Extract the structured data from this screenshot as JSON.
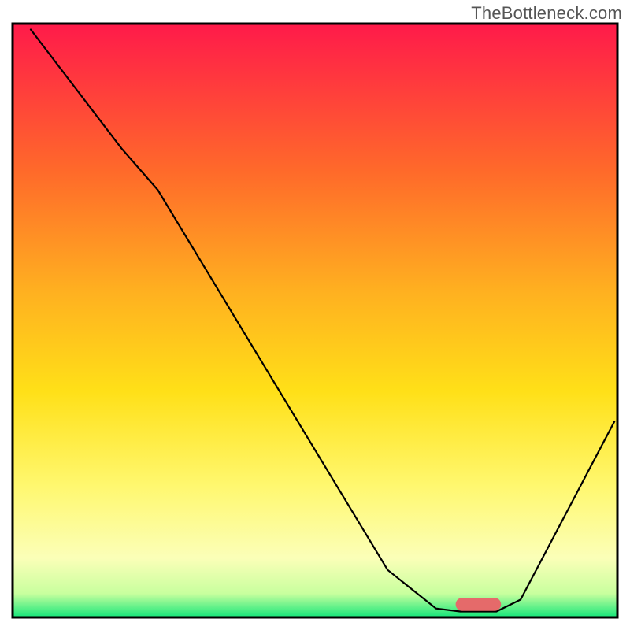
{
  "watermark": "TheBottleneck.com",
  "chart_data": {
    "type": "line",
    "title": "",
    "xlabel": "",
    "ylabel": "",
    "xlim": [
      0,
      100
    ],
    "ylim": [
      0,
      100
    ],
    "gradient_stops": [
      {
        "offset": 0.0,
        "color": "#ff1a4a"
      },
      {
        "offset": 0.25,
        "color": "#ff6a2a"
      },
      {
        "offset": 0.45,
        "color": "#ffb020"
      },
      {
        "offset": 0.62,
        "color": "#ffe018"
      },
      {
        "offset": 0.78,
        "color": "#fff870"
      },
      {
        "offset": 0.9,
        "color": "#fbffb8"
      },
      {
        "offset": 0.96,
        "color": "#c8ff9e"
      },
      {
        "offset": 1.0,
        "color": "#14e67a"
      }
    ],
    "border_color": "#000000",
    "series": [
      {
        "name": "bottleneck-curve",
        "type": "path",
        "stroke": "#000000",
        "stroke_width": 2.2,
        "points": [
          {
            "x": 3.0,
            "y": 99.0
          },
          {
            "x": 18.0,
            "y": 79.0
          },
          {
            "x": 24.0,
            "y": 72.0
          },
          {
            "x": 62.0,
            "y": 8.0
          },
          {
            "x": 70.0,
            "y": 1.5
          },
          {
            "x": 74.0,
            "y": 1.0
          },
          {
            "x": 80.0,
            "y": 1.0
          },
          {
            "x": 84.0,
            "y": 3.0
          },
          {
            "x": 99.5,
            "y": 33.0
          }
        ]
      },
      {
        "name": "optimal-marker",
        "type": "capsule",
        "fill": "#e56a6a",
        "cx": 77.0,
        "cy": 2.2,
        "width": 7.5,
        "height": 2.2
      }
    ]
  }
}
